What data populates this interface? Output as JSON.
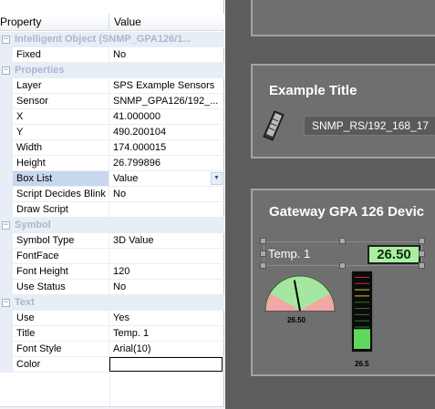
{
  "grid": {
    "header": {
      "property": "Property",
      "value": "Value"
    },
    "rows": [
      {
        "type": "category",
        "label": "Intelligent Object (SNMP_GPA126/1...",
        "toggle": "−"
      },
      {
        "type": "prop",
        "name": "Fixed",
        "value": "No"
      },
      {
        "type": "category",
        "label": "Properties",
        "toggle": "−"
      },
      {
        "type": "prop",
        "name": "Layer",
        "value": "SPS Example Sensors"
      },
      {
        "type": "prop",
        "name": "Sensor",
        "value": "SNMP_GPA126/192_..."
      },
      {
        "type": "prop",
        "name": "X",
        "value": "41.000000"
      },
      {
        "type": "prop",
        "name": "Y",
        "value": "490.200104"
      },
      {
        "type": "prop",
        "name": "Width",
        "value": "174.000015"
      },
      {
        "type": "prop",
        "name": "Height",
        "value": "26.799896"
      },
      {
        "type": "prop",
        "name": "Box List",
        "value": "Value",
        "selected": true,
        "dropdown": "▼"
      },
      {
        "type": "prop",
        "name": "Script Decides Blink",
        "value": "No"
      },
      {
        "type": "prop",
        "name": "Draw Script",
        "value": ""
      },
      {
        "type": "category",
        "label": "Symbol",
        "toggle": "−"
      },
      {
        "type": "prop",
        "name": "Symbol Type",
        "value": "3D Value"
      },
      {
        "type": "prop",
        "name": "FontFace",
        "value": ""
      },
      {
        "type": "prop",
        "name": "Font Height",
        "value": "120"
      },
      {
        "type": "prop",
        "name": "Use Status",
        "value": "No"
      },
      {
        "type": "category",
        "label": "Text",
        "toggle": "−"
      },
      {
        "type": "prop",
        "name": "Use",
        "value": "Yes"
      },
      {
        "type": "prop",
        "name": "Title",
        "value": "Temp. 1"
      },
      {
        "type": "prop",
        "name": "Font Style",
        "value": "Arial(10)"
      },
      {
        "type": "prop",
        "name": "Color",
        "value": "",
        "editing": true
      }
    ]
  },
  "canvas": {
    "example_panel": {
      "title": "Example Title",
      "sensor_label": "SNMP_RS/192_168_17",
      "icon": "rs-sensor-icon"
    },
    "gateway_panel": {
      "title": "Gateway GPA 126 Devic",
      "value_box": {
        "label": "Temp. 1",
        "value": "26.50"
      },
      "gauge": {
        "value": 26.5,
        "min": 0,
        "max": 60,
        "caption": "26.50"
      },
      "bar": {
        "value": 26.5,
        "min": 0,
        "max": 100,
        "caption": "26.5"
      }
    }
  },
  "colors": {
    "category_text": "#a9b8cc",
    "selection": "#c6d7ee",
    "canvas_bg": "#5d5d5d",
    "panel_bg": "#6f6f6f",
    "value_green": "#a9f0a0"
  }
}
